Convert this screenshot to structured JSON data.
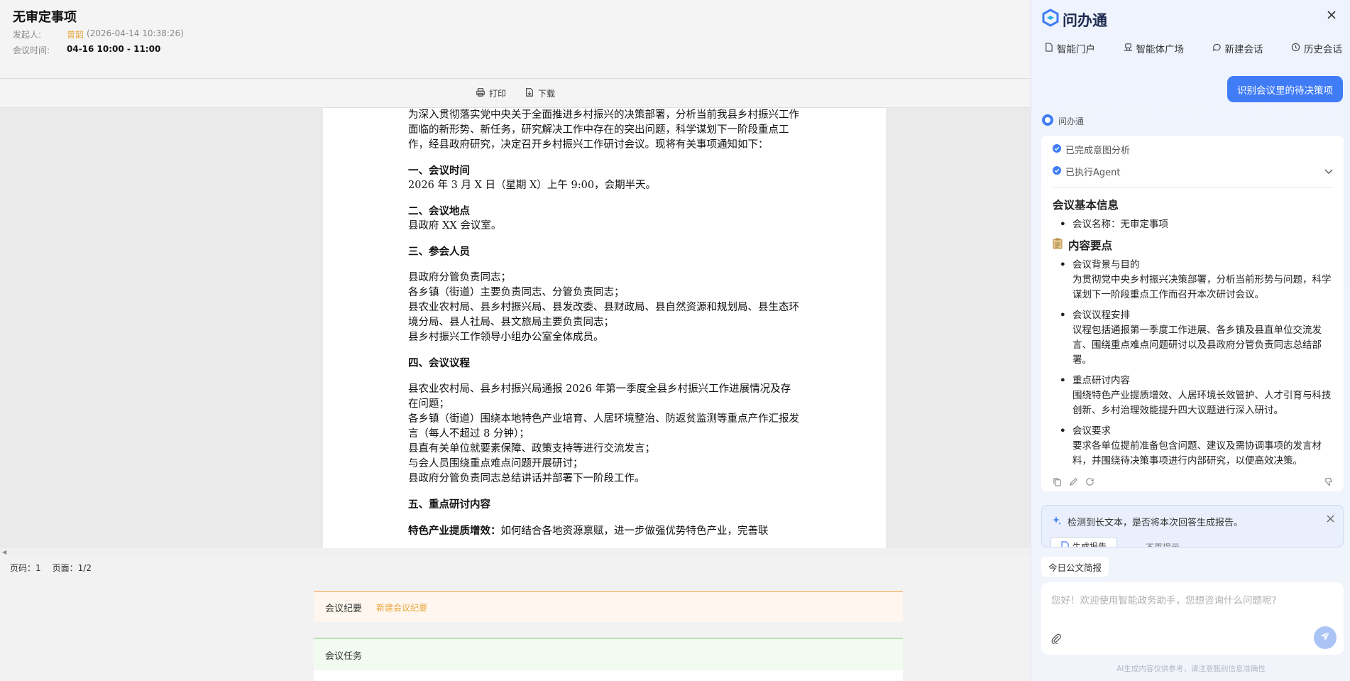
{
  "meeting": {
    "title": "无审定事项",
    "initiator_label": "发起人:",
    "initiator_name": "曾韶",
    "initiator_date": "(2026-04-14 10:38:26)",
    "time_label": "会议时间:",
    "time_value": "04-16 10:00 - 11:00"
  },
  "doc_toolbar": {
    "print": "打印",
    "download": "下载"
  },
  "document": {
    "intro": "为深入贯彻落实党中央关于全面推进乡村振兴的决策部署，分析当前我县乡村振兴工作面临的新形势、新任务，研究解决工作中存在的突出问题，科学谋划下一阶段重点工作，经县政府研究，决定召开乡村振兴工作研讨会议。现将有关事项通知如下：",
    "s1_title": "一、会议时间",
    "s1_text": "2026 年 3 月 X 日（星期 X）上午 9:00，会期半天。",
    "s2_title": "二、会议地点",
    "s2_text": "县政府 XX 会议室。",
    "s3_title": "三、参会人员",
    "s3_lines": [
      "县政府分管负责同志；",
      "各乡镇（街道）主要负责同志、分管负责同志；",
      "县农业农村局、县乡村振兴局、县发改委、县财政局、县自然资源和规划局、县生态环境分局、县人社局、县文旅局主要负责同志；",
      "县乡村振兴工作领导小组办公室全体成员。"
    ],
    "s4_title": "四、会议议程",
    "s4_lines": [
      "县农业农村局、县乡村振兴局通报 2026 年第一季度全县乡村振兴工作进展情况及存在问题；",
      "各乡镇（街道）围绕本地特色产业培育、人居环境整治、防返贫监测等重点产作汇报发言（每人不超过 8 分钟）；",
      "县直有关单位就要素保障、政策支持等进行交流发言；",
      "与会人员围绕重点难点问题开展研讨；",
      "县政府分管负责同志总结讲话并部署下一阶段工作。"
    ],
    "s5_title": "五、重点研讨内容",
    "s5_partial_bold": "特色产业提质增效：",
    "s5_partial_text": "如何结合各地资源禀赋，进一步做强优势特色产业，完善联"
  },
  "page_status": {
    "page_no": "页码：1",
    "page_count": "页面：1/2"
  },
  "minutes": {
    "label": "会议纪要",
    "new_link": "新建会议纪要"
  },
  "tasks": {
    "label": "会议任务"
  },
  "assistant": {
    "brand": "问办通",
    "nav": [
      "智能门户",
      "智能体广场",
      "新建会话",
      "历史会话"
    ],
    "user_message": "识别会议里的待决策项",
    "assistant_name": "问办通",
    "steps": [
      "已完成意图分析",
      "已执行Agent"
    ],
    "sec1_title": "会议基本信息",
    "sec1_items": [
      "会议名称：无审定事项"
    ],
    "sec2_title": "内容要点",
    "sec2_items": [
      {
        "title": "会议背景与目的",
        "desc": "为贯彻党中央乡村振兴决策部署，分析当前形势与问题，科学谋划下一阶段重点工作而召开本次研讨会议。"
      },
      {
        "title": "会议议程安排",
        "desc": "议程包括通报第一季度工作进展、各乡镇及县直单位交流发言、围绕重点难点问题研讨以及县政府分管负责同志总结部署。"
      },
      {
        "title": "重点研讨内容",
        "desc": "围绕特色产业提质增效、人居环境长效管护、人才引育与科技创新、乡村治理效能提升四大议题进行深入研讨。"
      },
      {
        "title": "会议要求",
        "desc": "要求各单位提前准备包含问题、建议及需协调事项的发言材料，并围绕待决策事项进行内部研究，以便高效决策。"
      }
    ],
    "report_prompt": "检测到长文本，是否将本次回答生成报告。",
    "report_button": "生成报告",
    "no_more": "不再提示",
    "quick_chip": "今日公文简报",
    "input_placeholder": "您好！欢迎使用智能政务助手，您想咨询什么问题呢?",
    "disclaimer": "AI生成内容仅供参考，请注意甄别信息准确性"
  },
  "colors": {
    "accent": "#3f7cf6",
    "initiator": "#e8a53a",
    "minutes_border": "#f5c690",
    "tasks_border": "#b9e0b4"
  }
}
